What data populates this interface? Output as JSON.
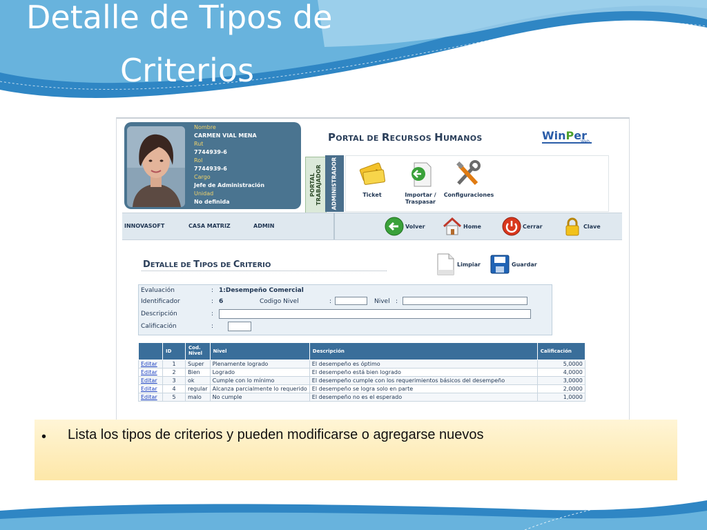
{
  "slide": {
    "title_line1": "Detalle de Tipos de",
    "title_line2": "Criterios",
    "note_bullet": "•",
    "note_text": "Lista los tipos de criterios y pueden modificarse o agregarse nuevos"
  },
  "user": {
    "nombre_label": "Nombre",
    "nombre": "CARMEN VIAL MENA",
    "rut_label": "Rut",
    "rut": "7744939-6",
    "rol_label": "Rol",
    "rol": "7744939-6",
    "cargo_label": "Cargo",
    "cargo": "Jefe de Administración",
    "unidad_label": "Unidad",
    "unidad": "No definida"
  },
  "portal": {
    "title_P": "P",
    "title_rest1": "ORTAL DE ",
    "title_R": "R",
    "title_rest2": "ECURSOS ",
    "title_H": "H",
    "title_rest3": "UMANOS",
    "logo_a": "Win",
    "logo_b": "P",
    "logo_c": "er",
    "logo_web": "Web",
    "tab_trabajador": "PORTAL\nTRABAJADOR",
    "tab_admin": "ADMINISTRADOR",
    "menu": [
      {
        "label": "Ticket",
        "icon": "ticket-icon"
      },
      {
        "label": "Importar /\nTraspasar",
        "icon": "import-icon"
      },
      {
        "label": "Configuraciones",
        "icon": "tools-icon"
      }
    ]
  },
  "nav": {
    "company": "INNOVASOFT",
    "branch": "CASA MATRIZ",
    "user": "ADMIN",
    "volver": "Volver",
    "home": "Home",
    "cerrar": "Cerrar",
    "clave": "Clave"
  },
  "form": {
    "title_D": "D",
    "title_rest1": "ETALLE DE ",
    "title_T": "T",
    "title_rest2": "IPOS DE ",
    "title_C": "C",
    "title_rest3": "RITERIO",
    "limpiar": "Limpiar",
    "guardar": "Guardar",
    "evaluacion_label": "Evaluación",
    "evaluacion_value": "1:Desempeño Comercial",
    "identificador_label": "Identificador",
    "identificador_value": "6",
    "codigo_nivel_label": "Codigo Nivel",
    "nivel_label": "Nivel",
    "descripcion_label": "Descripción",
    "calificacion_label": "Calificación",
    "colon": ":",
    "codigo_nivel_value": "",
    "nivel_value": "",
    "descripcion_value": "",
    "calificacion_value": ""
  },
  "grid": {
    "headers": [
      "",
      "ID",
      "Cod.\nNivel",
      "Nivel",
      "Descripción",
      "Calificación"
    ],
    "rows": [
      {
        "action": "Editar",
        "id": "1",
        "cod": "Super",
        "nivel": "Plenamente logrado",
        "desc": "El desempeño es óptimo",
        "calif": "5,0000"
      },
      {
        "action": "Editar",
        "id": "2",
        "cod": "Bien",
        "nivel": "Logrado",
        "desc": "El desempeño está bien logrado",
        "calif": "4,0000"
      },
      {
        "action": "Editar",
        "id": "3",
        "cod": "ok",
        "nivel": "Cumple con lo mínimo",
        "desc": "El desempeño cumple con los requerimientos básicos del desempeño",
        "calif": "3,0000"
      },
      {
        "action": "Editar",
        "id": "4",
        "cod": "regular",
        "nivel": "Alcanza parcialmente lo requerido",
        "desc": "El desempeño se logra solo en parte",
        "calif": "2,0000"
      },
      {
        "action": "Editar",
        "id": "5",
        "cod": "malo",
        "nivel": "No cumple",
        "desc": "El desempeño no es el esperado",
        "calif": "1,0000"
      }
    ]
  }
}
